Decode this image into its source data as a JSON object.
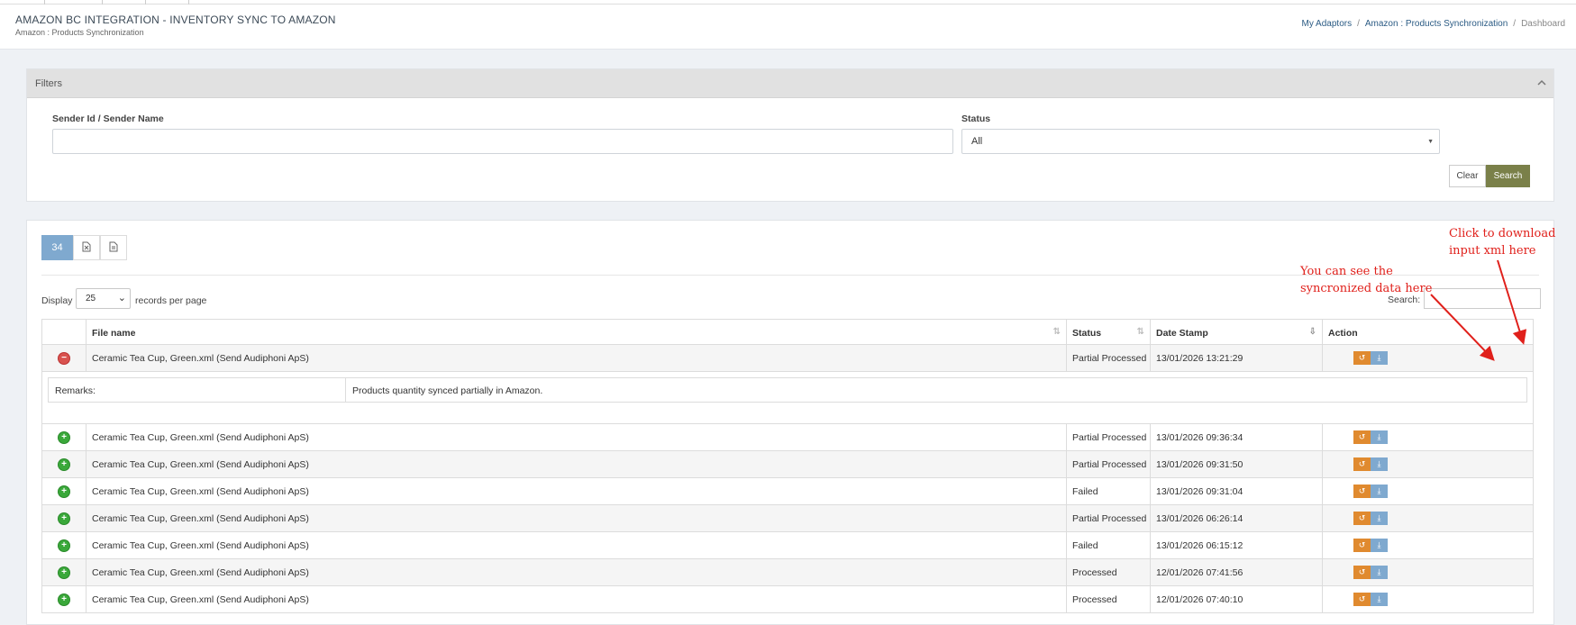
{
  "header": {
    "title": "AMAZON BC INTEGRATION - INVENTORY SYNC TO AMAZON",
    "subtitle": "Amazon : Products Synchronization",
    "breadcrumb": [
      "My Adaptors",
      "Amazon : Products Synchronization",
      "Dashboard"
    ]
  },
  "filters": {
    "title": "Filters",
    "sender_label": "Sender Id / Sender Name",
    "sender_value": "",
    "status_label": "Status",
    "status_value": "All",
    "clear_label": "Clear",
    "search_label": "Search"
  },
  "results": {
    "count": "34",
    "display_label": "Display",
    "page_size": "25",
    "records_label": "records per page",
    "search_label": "Search:",
    "columns": [
      "File name",
      "Status",
      "Date Stamp",
      "Action"
    ],
    "remarks_key": "Remarks:",
    "remarks_value": "Products quantity synced partially in Amazon.",
    "rows": [
      {
        "file": "Ceramic Tea Cup, Green.xml (Send Audiphoni ApS)",
        "status": "Partial Processed",
        "date": "13/01/2026 13:21:29",
        "expanded": true
      },
      {
        "file": "Ceramic Tea Cup, Green.xml (Send Audiphoni ApS)",
        "status": "Partial Processed",
        "date": "13/01/2026 09:36:34",
        "expanded": false
      },
      {
        "file": "Ceramic Tea Cup, Green.xml (Send Audiphoni ApS)",
        "status": "Partial Processed",
        "date": "13/01/2026 09:31:50",
        "expanded": false
      },
      {
        "file": "Ceramic Tea Cup, Green.xml (Send Audiphoni ApS)",
        "status": "Failed",
        "date": "13/01/2026 09:31:04",
        "expanded": false
      },
      {
        "file": "Ceramic Tea Cup, Green.xml (Send Audiphoni ApS)",
        "status": "Partial Processed",
        "date": "13/01/2026 06:26:14",
        "expanded": false
      },
      {
        "file": "Ceramic Tea Cup, Green.xml (Send Audiphoni ApS)",
        "status": "Failed",
        "date": "13/01/2026 06:15:12",
        "expanded": false
      },
      {
        "file": "Ceramic Tea Cup, Green.xml (Send Audiphoni ApS)",
        "status": "Processed",
        "date": "12/01/2026 07:41:56",
        "expanded": false
      },
      {
        "file": "Ceramic Tea Cup, Green.xml (Send Audiphoni ApS)",
        "status": "Processed",
        "date": "12/01/2026 07:40:10",
        "expanded": false
      }
    ]
  },
  "annotations": {
    "download_note": [
      "Click to download",
      "input xml here"
    ],
    "view_note": [
      "You can see the",
      "syncronized data here"
    ]
  },
  "colors": {
    "accent_blue": "#7fa9cf",
    "search_button": "#7a8049",
    "view_button": "#e08a2f",
    "annotation_red": "#e0201b"
  }
}
